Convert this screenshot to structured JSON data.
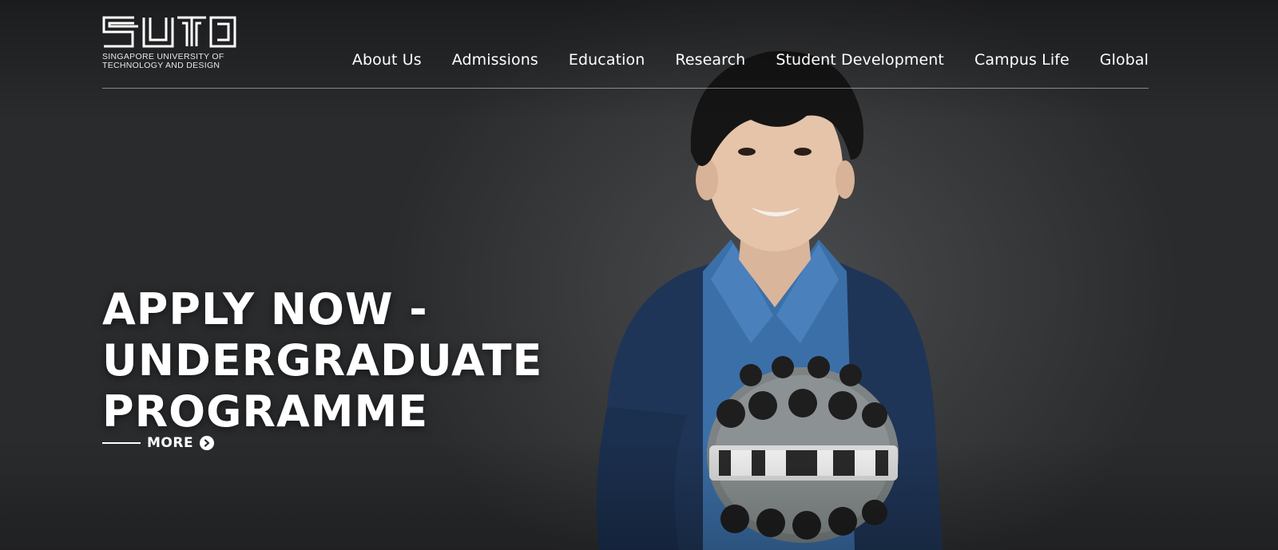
{
  "logo": {
    "line1": "SINGAPORE UNIVERSITY OF",
    "line2": "TECHNOLOGY AND DESIGN"
  },
  "nav": {
    "items": [
      {
        "label": "About Us"
      },
      {
        "label": "Admissions"
      },
      {
        "label": "Education"
      },
      {
        "label": "Research"
      },
      {
        "label": "Student Development"
      },
      {
        "label": "Campus Life"
      },
      {
        "label": "Global"
      }
    ]
  },
  "hero": {
    "headline_line1": "APPLY NOW -",
    "headline_line2": "UNDERGRADUATE",
    "headline_line3": "PROGRAMME",
    "more_label": "MORE"
  },
  "colors": {
    "background": "#2b2c2e",
    "text": "#ffffff",
    "shirt": "#3b6fa8",
    "cardigan": "#1f3557"
  },
  "icons": {
    "more": "chevron-circle-right-icon"
  }
}
